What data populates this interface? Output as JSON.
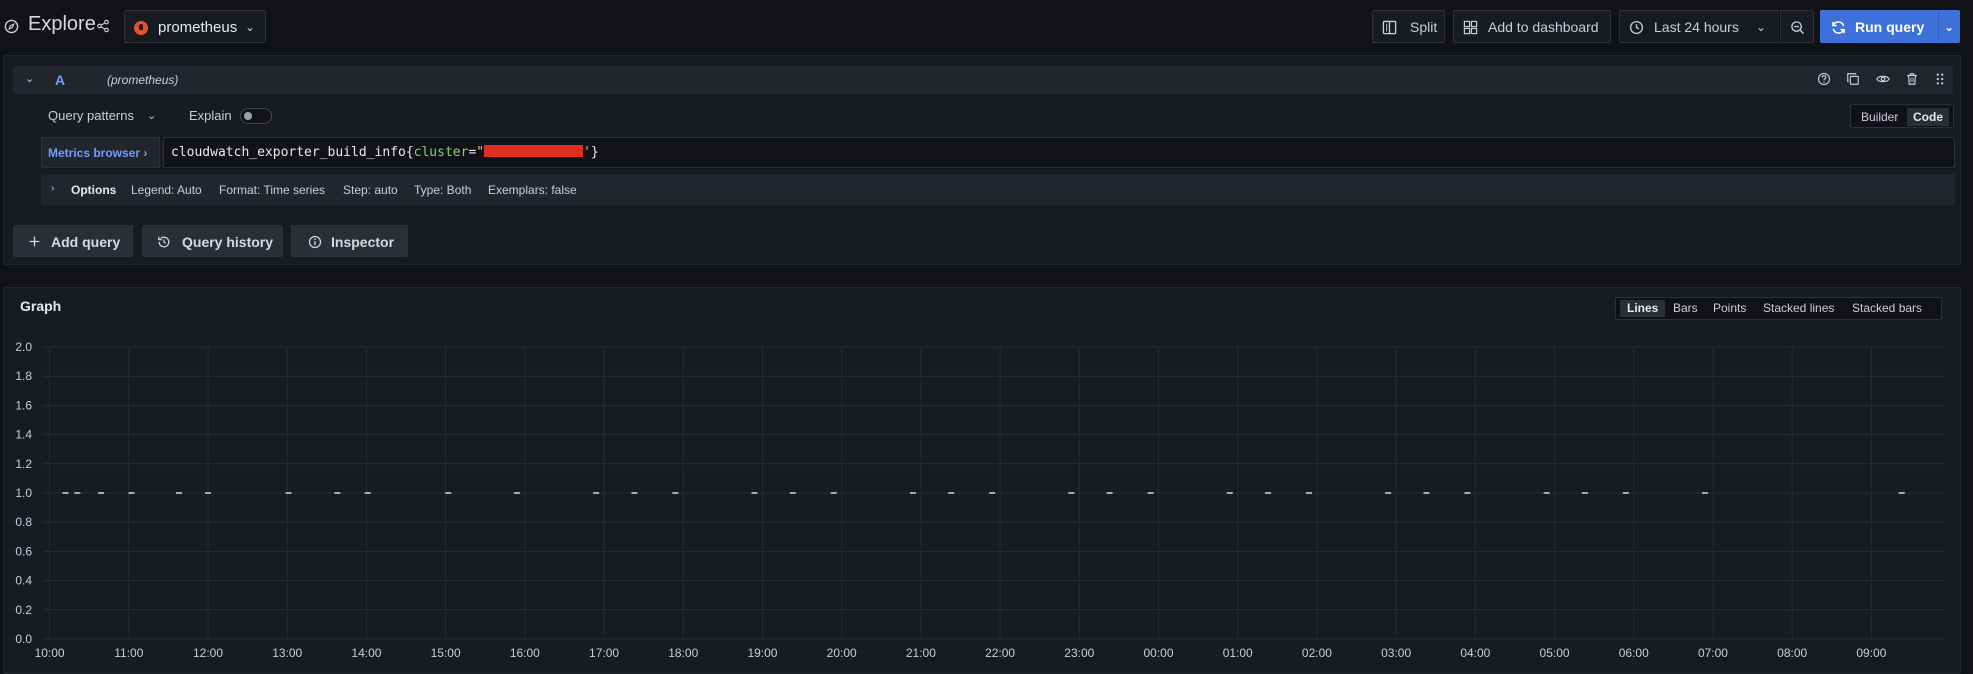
{
  "header": {
    "title": "Explore",
    "datasource": "prometheus",
    "split_label": "Split",
    "add_dashboard_label": "Add to dashboard",
    "time_range": "Last 24 hours",
    "run_query_label": "Run query"
  },
  "query": {
    "letter": "A",
    "datasource_hint": "(prometheus)",
    "patterns_label": "Query patterns",
    "explain_label": "Explain",
    "explain_enabled": false,
    "mode_builder": "Builder",
    "mode_code": "Code",
    "mode_active": "Code",
    "metrics_browser_label": "Metrics browser ›",
    "expr_metric": "cloudwatch_exporter_build_info",
    "expr_open": "{",
    "expr_label": "cluster",
    "expr_eq": "=",
    "expr_quote_open": "\"",
    "expr_quote_close": "'",
    "expr_close": "}",
    "options_title": "Options",
    "options": {
      "legend": "Legend: Auto",
      "format": "Format: Time series",
      "step": "Step: auto",
      "type": "Type: Both",
      "exemplars": "Exemplars: false"
    }
  },
  "actions": {
    "add_query": "Add query",
    "query_history": "Query history",
    "inspector": "Inspector"
  },
  "graph": {
    "title": "Graph",
    "viz_options": [
      "Lines",
      "Bars",
      "Points",
      "Stacked lines",
      "Stacked bars"
    ],
    "viz_active": "Lines"
  },
  "colors": {
    "accent": "#3d71d9",
    "link": "#6e9fff",
    "redaction": "#e02f22",
    "series": "#d0d0b8"
  },
  "chart_data": {
    "type": "scatter",
    "title": "",
    "xlabel": "",
    "ylabel": "",
    "ylim": [
      0,
      2
    ],
    "yticks": [
      "0.0",
      "0.2",
      "0.4",
      "0.6",
      "0.8",
      "1.0",
      "1.2",
      "1.4",
      "1.6",
      "1.8",
      "2.0"
    ],
    "xlim": [
      "09:55",
      "09:55+1d"
    ],
    "xticks": [
      "10:00",
      "11:00",
      "12:00",
      "13:00",
      "14:00",
      "15:00",
      "16:00",
      "17:00",
      "18:00",
      "19:00",
      "20:00",
      "21:00",
      "22:00",
      "23:00",
      "00:00",
      "01:00",
      "02:00",
      "03:00",
      "04:00",
      "05:00",
      "06:00",
      "07:00",
      "08:00",
      "09:00"
    ],
    "grid": true,
    "series": [
      {
        "x": [
          "10:12",
          "10:21",
          "10:39",
          "11:02",
          "11:38",
          "12:00",
          "13:01",
          "13:38",
          "14:01",
          "15:02",
          "15:54",
          "16:54",
          "17:23",
          "17:54",
          "18:54",
          "19:23",
          "19:54",
          "20:54",
          "21:23",
          "21:54",
          "22:54",
          "23:23",
          "23:54",
          "00:54",
          "01:23",
          "01:54",
          "02:54",
          "03:23",
          "03:54",
          "04:54",
          "05:23",
          "05:54",
          "06:54",
          "09:23"
        ],
        "y": [
          1,
          1,
          1,
          1,
          1,
          1,
          1,
          1,
          1,
          1,
          1,
          1,
          1,
          1,
          1,
          1,
          1,
          1,
          1,
          1,
          1,
          1,
          1,
          1,
          1,
          1,
          1,
          1,
          1,
          1,
          1,
          1,
          1,
          1
        ]
      }
    ]
  }
}
